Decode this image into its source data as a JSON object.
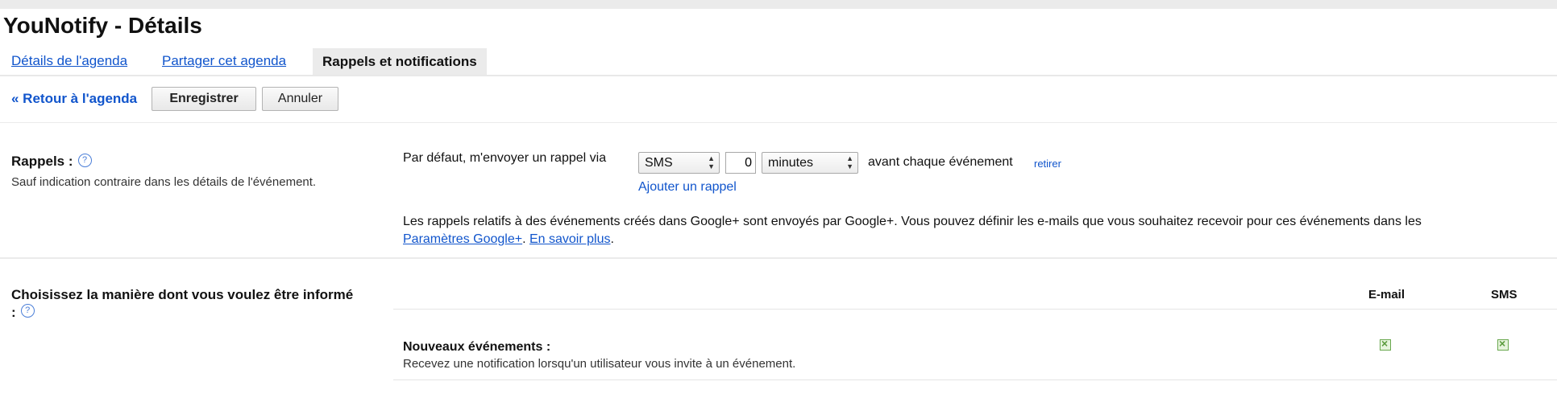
{
  "page": {
    "title": "YouNotify - Détails"
  },
  "tabs": [
    {
      "label": "Détails de l'agenda"
    },
    {
      "label": "Partager cet agenda"
    },
    {
      "label": "Rappels et notifications"
    }
  ],
  "toolbar": {
    "back_label": "« Retour à l'agenda",
    "save_label": "Enregistrer",
    "cancel_label": "Annuler"
  },
  "reminders": {
    "title": "Rappels :",
    "help": "?",
    "subtitle": "Sauf indication contraire dans les détails de l'événement.",
    "default_prefix": "Par défaut, m'envoyer un rappel via",
    "method_value": "SMS",
    "amount_value": "0",
    "unit_value": "minutes",
    "suffix": "avant chaque événement",
    "remove_label": "retirer",
    "add_label": "Ajouter un rappel",
    "info_text": "Les rappels relatifs à des événements créés dans Google+ sont envoyés par Google+. Vous pouvez définir les e-mails que vous souhaitez recevoir pour ces événements dans les",
    "info_link_settings": "Paramètres Google+",
    "info_link_learn": "En savoir plus"
  },
  "notifications": {
    "title_line1": "Choisissez la manière dont vous voulez être informé",
    "title_line2": ":",
    "help": "?",
    "columns": [
      "E-mail",
      "SMS"
    ],
    "rows": [
      {
        "title": "Nouveaux événements :",
        "description": "Recevez une notification lorsqu'un utilisateur vous invite à un événement.",
        "email": true,
        "sms": true
      }
    ]
  },
  "icons": {
    "help": "help-circle-icon",
    "select_arrows": "updown-arrows-icon",
    "checkbox": "checkbox-icon"
  }
}
